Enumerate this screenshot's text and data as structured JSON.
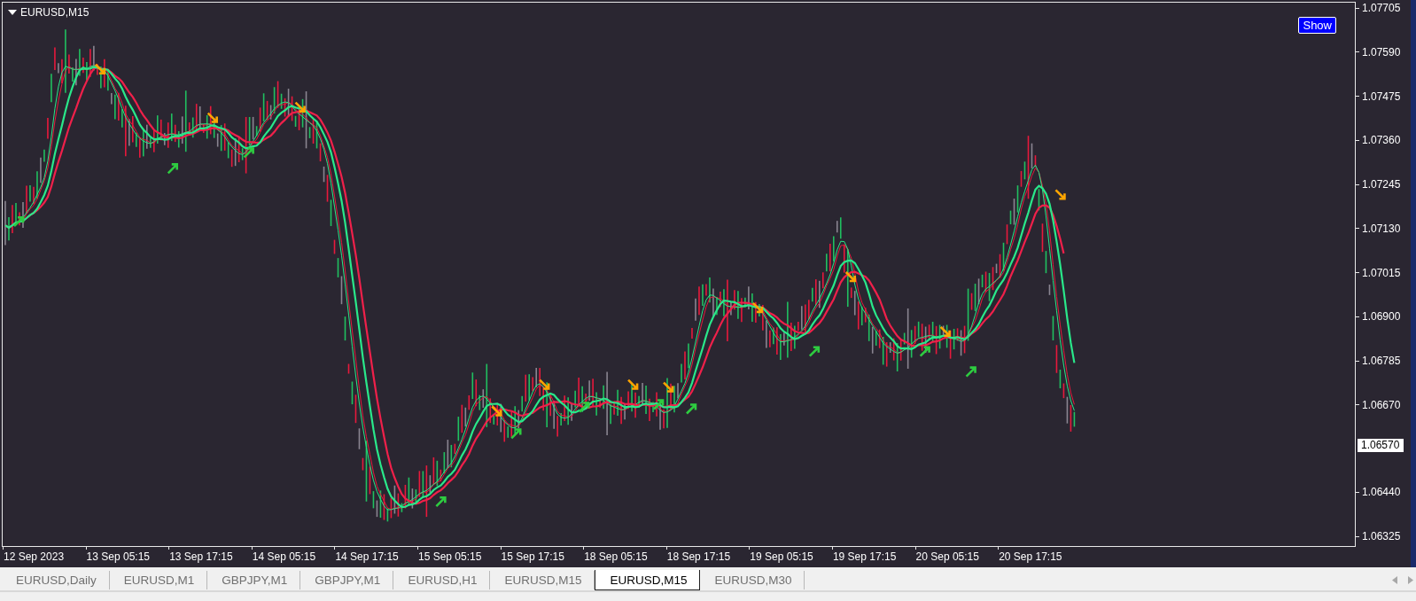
{
  "chart": {
    "title": "EURUSD,M15",
    "show_button": "Show",
    "price_axis": [
      {
        "kind": "tick",
        "label": "1.07705"
      },
      {
        "kind": "tick",
        "label": "1.07590"
      },
      {
        "kind": "tick",
        "label": "1.07475"
      },
      {
        "kind": "tick",
        "label": "1.07360"
      },
      {
        "kind": "tick",
        "label": "1.07245"
      },
      {
        "kind": "tick",
        "label": "1.07130"
      },
      {
        "kind": "tick",
        "label": "1.07015"
      },
      {
        "kind": "tick",
        "label": "1.06900"
      },
      {
        "kind": "tick",
        "label": "1.06785"
      },
      {
        "kind": "tick",
        "label": "1.06670"
      },
      {
        "kind": "current",
        "label": "1.06570"
      },
      {
        "kind": "tick",
        "label": "1.06440"
      },
      {
        "kind": "tick",
        "label": "1.06325"
      }
    ],
    "time_axis": [
      "12 Sep 2023",
      "13 Sep 05:15",
      "13 Sep 17:15",
      "14 Sep 05:15",
      "14 Sep 17:15",
      "15 Sep 05:15",
      "15 Sep 17:15",
      "18 Sep 05:15",
      "18 Sep 17:15",
      "19 Sep 05:15",
      "19 Sep 17:15",
      "20 Sep 05:15",
      "20 Sep 17:15"
    ]
  },
  "tabs": [
    {
      "label": "EURUSD,Daily",
      "selected": false
    },
    {
      "label": "EURUSD,M1",
      "selected": false
    },
    {
      "label": "GBPJPY,M1",
      "selected": false
    },
    {
      "label": "GBPJPY,M1",
      "selected": false
    },
    {
      "label": "EURUSD,H1",
      "selected": false
    },
    {
      "label": "EURUSD,M15",
      "selected": false
    },
    {
      "label": "EURUSD,M15",
      "selected": true
    },
    {
      "label": "EURUSD,M30",
      "selected": false
    }
  ]
}
